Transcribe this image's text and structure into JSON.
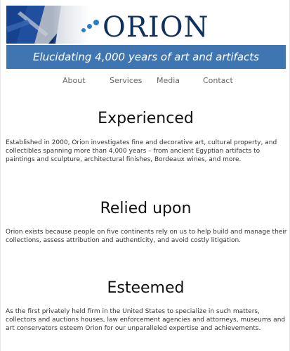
{
  "brand": {
    "name": "ORION",
    "tagline": "Elucidating 4,000 years of art and artifacts",
    "colors": {
      "navy": "#0f2f5f",
      "accent_blue": "#2a7fc9",
      "tagline_bar": "#3f76b2"
    }
  },
  "nav": {
    "items": [
      "About",
      "Services",
      "Media",
      "Contact"
    ]
  },
  "sections": [
    {
      "title": "Experienced",
      "body": "Established in 2000, Orion investigates fine and decorative art, cultural property, and collectibles spanning more than 4,000 years – from ancient Egyptian artifacts to paintings and sculpture, architectural finishes, Bordeaux wines, and more."
    },
    {
      "title": "Relied upon",
      "body": "Orion exists because people on five continents rely on us to help build and manage their collections, assess attribution and authenticity, and avoid costly litigation."
    },
    {
      "title": "Esteemed",
      "body": "As the first privately held firm in the United States to specialize in such matters, collectors and auctions houses, law enforcement agencies and attorneys, museums and art conservators esteem Orion for our unparalleled expertise and achievements."
    }
  ],
  "icons": {
    "header_art": "blue-abstract-artwork-image",
    "logo_mark": "three-dots-logo-mark"
  }
}
